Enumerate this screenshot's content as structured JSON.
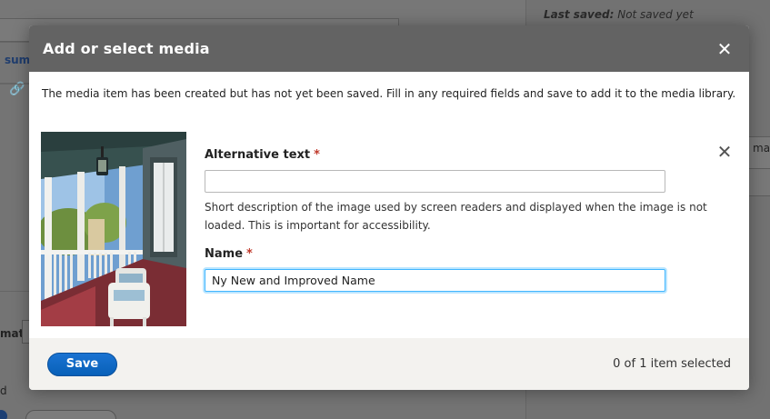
{
  "background": {
    "last_saved_label": "Last saved:",
    "last_saved_value": "Not saved yet",
    "summary_fragment": "sum",
    "format_fragment": "mat",
    "right_fragment": "mag",
    "edit_fragment": "d"
  },
  "dialog": {
    "title": "Add or select media",
    "close_icon": "close-icon",
    "message": "The media item has been created but has not yet been saved. Fill in any required fields and save to add it to the media library.",
    "remove_icon": "close-icon"
  },
  "fields": {
    "alt_text": {
      "label": "Alternative text",
      "required_mark": "*",
      "value": "",
      "description": "Short description of the image used by screen readers and displayed when the image is not loaded. This is important for accessibility."
    },
    "name": {
      "label": "Name",
      "required_mark": "*",
      "value": "Ny New and Improved Name"
    }
  },
  "footer": {
    "save_label": "Save",
    "selection_status": "0 of 1 item selected"
  },
  "colors": {
    "titlebar": "#636363",
    "primary_button": "#0860b8",
    "focus_ring": "#40b6ff",
    "required": "#c0392b",
    "footer_bg": "#f3f2ef"
  }
}
